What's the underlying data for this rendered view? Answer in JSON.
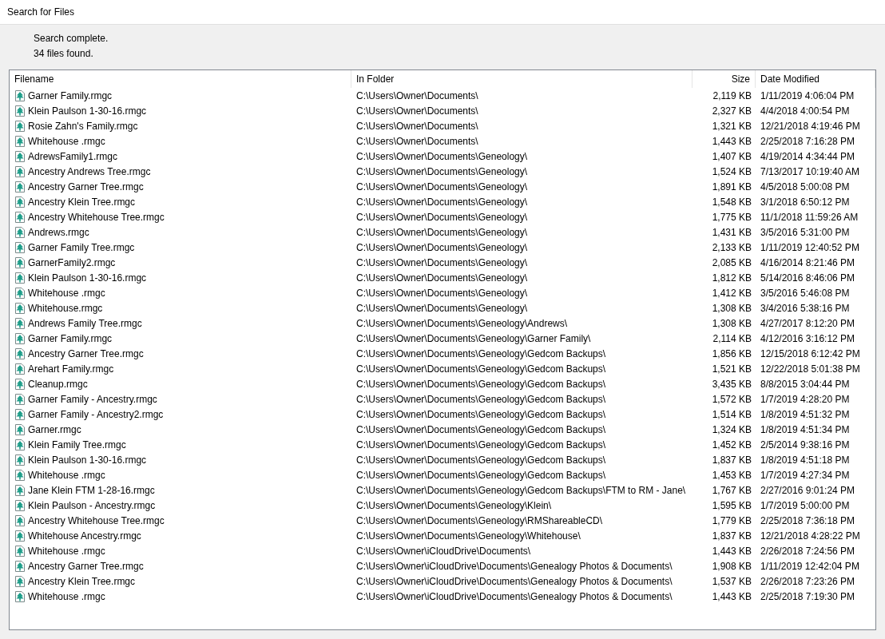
{
  "window": {
    "title": "Search for Files"
  },
  "status": [
    "Search complete.",
    "34 files found."
  ],
  "table": {
    "columns": [
      "Filename",
      "In Folder",
      "Size",
      "Date Modified"
    ],
    "rows": [
      [
        "Garner Family.rmgc",
        "C:\\Users\\Owner\\Documents\\",
        "2,119 KB",
        "1/11/2019 4:06:04 PM"
      ],
      [
        "Klein Paulson 1-30-16.rmgc",
        "C:\\Users\\Owner\\Documents\\",
        "2,327 KB",
        "4/4/2018 4:00:54 PM"
      ],
      [
        "Rosie Zahn's Family.rmgc",
        "C:\\Users\\Owner\\Documents\\",
        "1,321 KB",
        "12/21/2018 4:19:46 PM"
      ],
      [
        "Whitehouse .rmgc",
        "C:\\Users\\Owner\\Documents\\",
        "1,443 KB",
        "2/25/2018 7:16:28 PM"
      ],
      [
        "AdrewsFamily1.rmgc",
        "C:\\Users\\Owner\\Documents\\Geneology\\",
        "1,407 KB",
        "4/19/2014 4:34:44 PM"
      ],
      [
        "Ancestry Andrews Tree.rmgc",
        "C:\\Users\\Owner\\Documents\\Geneology\\",
        "1,524 KB",
        "7/13/2017 10:19:40 AM"
      ],
      [
        "Ancestry Garner Tree.rmgc",
        "C:\\Users\\Owner\\Documents\\Geneology\\",
        "1,891 KB",
        "4/5/2018 5:00:08 PM"
      ],
      [
        "Ancestry Klein Tree.rmgc",
        "C:\\Users\\Owner\\Documents\\Geneology\\",
        "1,548 KB",
        "3/1/2018 6:50:12 PM"
      ],
      [
        "Ancestry Whitehouse Tree.rmgc",
        "C:\\Users\\Owner\\Documents\\Geneology\\",
        "1,775 KB",
        "11/1/2018 11:59:26 AM"
      ],
      [
        "Andrews.rmgc",
        "C:\\Users\\Owner\\Documents\\Geneology\\",
        "1,431 KB",
        "3/5/2016 5:31:00 PM"
      ],
      [
        "Garner Family Tree.rmgc",
        "C:\\Users\\Owner\\Documents\\Geneology\\",
        "2,133 KB",
        "1/11/2019 12:40:52 PM"
      ],
      [
        "GarnerFamily2.rmgc",
        "C:\\Users\\Owner\\Documents\\Geneology\\",
        "2,085 KB",
        "4/16/2014 8:21:46 PM"
      ],
      [
        "Klein Paulson 1-30-16.rmgc",
        "C:\\Users\\Owner\\Documents\\Geneology\\",
        "1,812 KB",
        "5/14/2016 8:46:06 PM"
      ],
      [
        "Whitehouse .rmgc",
        "C:\\Users\\Owner\\Documents\\Geneology\\",
        "1,412 KB",
        "3/5/2016 5:46:08 PM"
      ],
      [
        "Whitehouse.rmgc",
        "C:\\Users\\Owner\\Documents\\Geneology\\",
        "1,308 KB",
        "3/4/2016 5:38:16 PM"
      ],
      [
        "Andrews Family Tree.rmgc",
        "C:\\Users\\Owner\\Documents\\Geneology\\Andrews\\",
        "1,308 KB",
        "4/27/2017 8:12:20 PM"
      ],
      [
        "Garner Family.rmgc",
        "C:\\Users\\Owner\\Documents\\Geneology\\Garner Family\\",
        "2,114 KB",
        "4/12/2016 3:16:12 PM"
      ],
      [
        "Ancestry Garner Tree.rmgc",
        "C:\\Users\\Owner\\Documents\\Geneology\\Gedcom Backups\\",
        "1,856 KB",
        "12/15/2018 6:12:42 PM"
      ],
      [
        "Arehart Family.rmgc",
        "C:\\Users\\Owner\\Documents\\Geneology\\Gedcom Backups\\",
        "1,521 KB",
        "12/22/2018 5:01:38 PM"
      ],
      [
        "Cleanup.rmgc",
        "C:\\Users\\Owner\\Documents\\Geneology\\Gedcom Backups\\",
        "3,435 KB",
        "8/8/2015 3:04:44 PM"
      ],
      [
        "Garner Family - Ancestry.rmgc",
        "C:\\Users\\Owner\\Documents\\Geneology\\Gedcom Backups\\",
        "1,572 KB",
        "1/7/2019 4:28:20 PM"
      ],
      [
        "Garner Family - Ancestry2.rmgc",
        "C:\\Users\\Owner\\Documents\\Geneology\\Gedcom Backups\\",
        "1,514 KB",
        "1/8/2019 4:51:32 PM"
      ],
      [
        "Garner.rmgc",
        "C:\\Users\\Owner\\Documents\\Geneology\\Gedcom Backups\\",
        "1,324 KB",
        "1/8/2019 4:51:34 PM"
      ],
      [
        "Klein Family Tree.rmgc",
        "C:\\Users\\Owner\\Documents\\Geneology\\Gedcom Backups\\",
        "1,452 KB",
        "2/5/2014 9:38:16 PM"
      ],
      [
        "Klein Paulson 1-30-16.rmgc",
        "C:\\Users\\Owner\\Documents\\Geneology\\Gedcom Backups\\",
        "1,837 KB",
        "1/8/2019 4:51:18 PM"
      ],
      [
        "Whitehouse .rmgc",
        "C:\\Users\\Owner\\Documents\\Geneology\\Gedcom Backups\\",
        "1,453 KB",
        "1/7/2019 4:27:34 PM"
      ],
      [
        "Jane Klein FTM 1-28-16.rmgc",
        "C:\\Users\\Owner\\Documents\\Geneology\\Gedcom Backups\\FTM to RM - Jane\\",
        "1,767 KB",
        "2/27/2016 9:01:24 PM"
      ],
      [
        "Klein Paulson - Ancestry.rmgc",
        "C:\\Users\\Owner\\Documents\\Geneology\\Klein\\",
        "1,595 KB",
        "1/7/2019 5:00:00 PM"
      ],
      [
        "Ancestry Whitehouse Tree.rmgc",
        "C:\\Users\\Owner\\Documents\\Geneology\\RMShareableCD\\",
        "1,779 KB",
        "2/25/2018 7:36:18 PM"
      ],
      [
        "Whitehouse Ancestry.rmgc",
        "C:\\Users\\Owner\\Documents\\Geneology\\Whitehouse\\",
        "1,837 KB",
        "12/21/2018 4:28:22 PM"
      ],
      [
        "Whitehouse .rmgc",
        "C:\\Users\\Owner\\iCloudDrive\\Documents\\",
        "1,443 KB",
        "2/26/2018 7:24:56 PM"
      ],
      [
        "Ancestry Garner Tree.rmgc",
        "C:\\Users\\Owner\\iCloudDrive\\Documents\\Genealogy Photos & Documents\\",
        "1,908 KB",
        "1/11/2019 12:42:04 PM"
      ],
      [
        "Ancestry Klein Tree.rmgc",
        "C:\\Users\\Owner\\iCloudDrive\\Documents\\Genealogy Photos & Documents\\",
        "1,537 KB",
        "2/26/2018 7:23:26 PM"
      ],
      [
        "Whitehouse .rmgc",
        "C:\\Users\\Owner\\iCloudDrive\\Documents\\Genealogy Photos & Documents\\",
        "1,443 KB",
        "2/25/2018 7:19:30 PM"
      ]
    ]
  }
}
